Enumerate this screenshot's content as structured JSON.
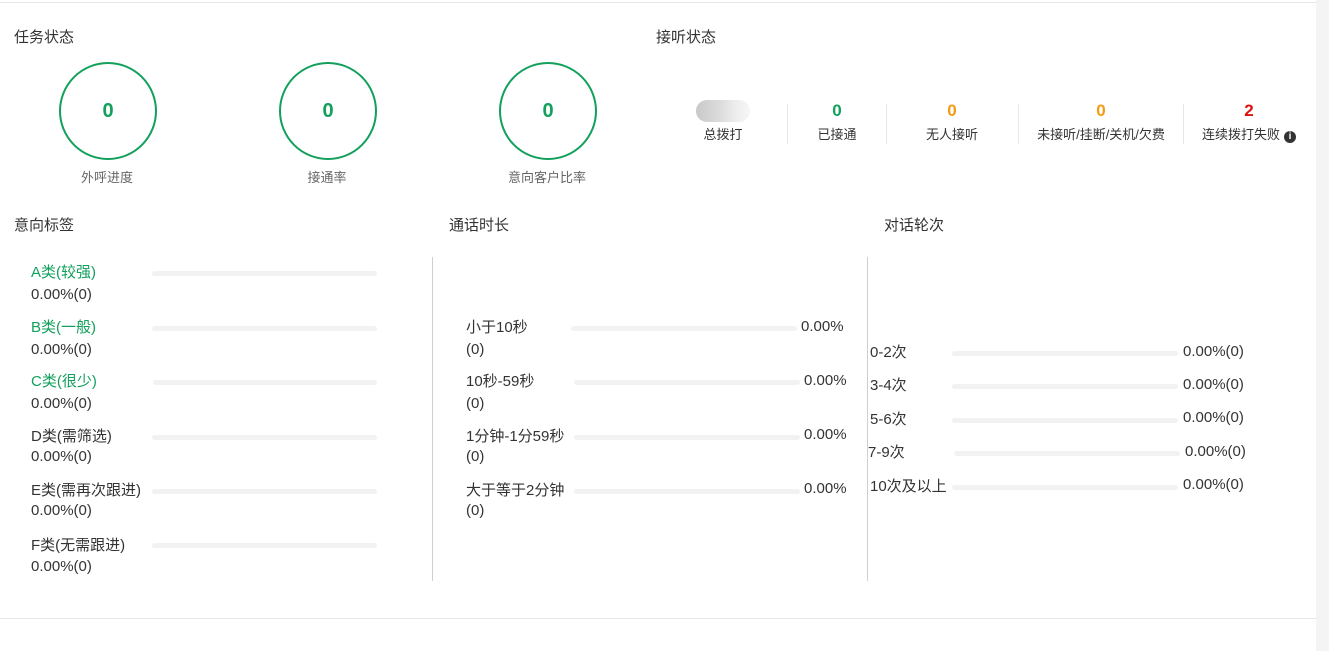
{
  "task_status": {
    "title": "任务状态",
    "circles": [
      {
        "value": "0",
        "label": "外呼进度"
      },
      {
        "value": "0",
        "label": "接通率"
      },
      {
        "value": "0",
        "label": "意向客户比率"
      }
    ]
  },
  "answer_status": {
    "title": "接听状态",
    "stats": [
      {
        "value": "",
        "label": "总拨打",
        "color": "#333333"
      },
      {
        "value": "0",
        "label": "已接通",
        "color": "#12a05c"
      },
      {
        "value": "0",
        "label": "无人接听",
        "color": "#f39c12"
      },
      {
        "value": "0",
        "label": "未接听/挂断/关机/欠费",
        "color": "#f39c12"
      },
      {
        "value": "2",
        "label": "连续拨打失败",
        "color": "#e01010"
      }
    ],
    "info_icon": "info-icon"
  },
  "intent_tags": {
    "title": "意向标签",
    "items": [
      {
        "label": "A类(较强)",
        "value": "0.00%(0)",
        "highlight": true
      },
      {
        "label": "B类(一般)",
        "value": "0.00%(0)",
        "highlight": true
      },
      {
        "label": "C类(很少)",
        "value": "0.00%(0)",
        "highlight": true
      },
      {
        "label": "D类(需筛选)",
        "value": "0.00%(0)",
        "highlight": false
      },
      {
        "label": "E类(需再次跟进)",
        "value": "0.00%(0)",
        "highlight": false
      },
      {
        "label": "F类(无需跟进)",
        "value": "0.00%(0)",
        "highlight": false
      }
    ]
  },
  "call_duration": {
    "title": "通话时长",
    "items": [
      {
        "label": "小于10秒",
        "count": "(0)",
        "percent": "0.00%"
      },
      {
        "label": "10秒-59秒",
        "count": "(0)",
        "percent": "0.00%"
      },
      {
        "label": "1分钟-1分59秒",
        "count": "(0)",
        "percent": "0.00%"
      },
      {
        "label": "大于等于2分钟",
        "count": "(0)",
        "percent": "0.00%"
      }
    ]
  },
  "dialog_rounds": {
    "title": "对话轮次",
    "items": [
      {
        "label": "0-2次",
        "value": "0.00%(0)"
      },
      {
        "label": "3-4次",
        "value": "0.00%(0)"
      },
      {
        "label": "5-6次",
        "value": "0.00%(0)"
      },
      {
        "label": "7-9次",
        "value": "0.00%(0)"
      },
      {
        "label": "10次及以上",
        "value": "0.00%(0)"
      }
    ]
  },
  "colors": {
    "accent_green": "#12a05c",
    "orange": "#f39c12",
    "red": "#e01010"
  }
}
